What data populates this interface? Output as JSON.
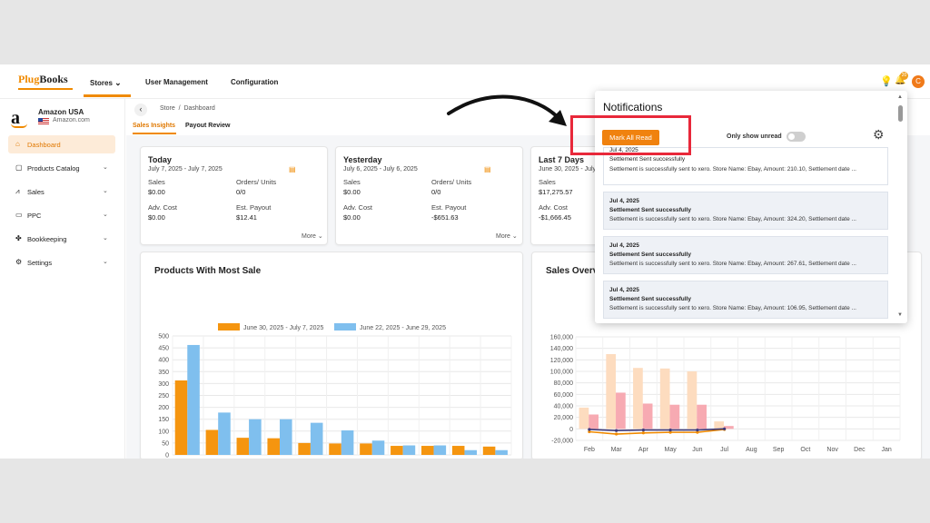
{
  "header": {
    "logo_part1": "Plug",
    "logo_part2": "Books",
    "nav": [
      "Stores",
      "User Management",
      "Configuration"
    ],
    "notification_count": "20",
    "avatar_initial": "C"
  },
  "store": {
    "name": "Amazon USA",
    "domain": "Amazon.com"
  },
  "sidebar": {
    "items": [
      {
        "label": "Dashboard",
        "icon": "home-icon",
        "active": true
      },
      {
        "label": "Products Catalog",
        "icon": "box-icon"
      },
      {
        "label": "Sales",
        "icon": "chart-icon"
      },
      {
        "label": "PPC",
        "icon": "ppc-icon"
      },
      {
        "label": "Bookkeeping",
        "icon": "book-icon"
      },
      {
        "label": "Settings",
        "icon": "gear-icon"
      }
    ]
  },
  "breadcrumb": {
    "store": "Store",
    "sep": "/",
    "page": "Dashboard"
  },
  "subtabs": [
    "Sales Insights",
    "Payout Review"
  ],
  "summary_cards": [
    {
      "title": "Today",
      "date": "July 7, 2025 - July 7, 2025",
      "sales_label": "Sales",
      "sales": "$0.00",
      "orders_label": "Orders/ Units",
      "orders": "0/0",
      "adv_label": "Adv. Cost",
      "adv": "$0.00",
      "payout_label": "Est. Payout",
      "payout": "$12.41",
      "more": "More"
    },
    {
      "title": "Yesterday",
      "date": "July 6, 2025 - July 6, 2025",
      "sales_label": "Sales",
      "sales": "$0.00",
      "orders_label": "Orders/ Units",
      "orders": "0/0",
      "adv_label": "Adv. Cost",
      "adv": "$0.00",
      "payout_label": "Est. Payout",
      "payout": "-$651.63",
      "more": "More"
    },
    {
      "title": "Last 7 Days",
      "date": "June 30, 2025 - July 6, 2025",
      "sales_label": "Sales",
      "sales": "$17,275.57",
      "adv_label": "Adv. Cost",
      "adv": "-$1,666.45"
    }
  ],
  "notifications": {
    "title": "Notifications",
    "mark_all": "Mark All Read",
    "only_unread": "Only show unread",
    "items": [
      {
        "date": "Jul 4, 2025",
        "title": "Settlement Sent successfully",
        "body": "Settlement is successfully sent to xero. Store Name: Ebay, Amount: 210.10, Settlement date ..."
      },
      {
        "date": "Jul 4, 2025",
        "title": "Settlement Sent successfully",
        "body": "Settlement is successfully sent to xero. Store Name: Ebay, Amount: 324.20, Settlement date ..."
      },
      {
        "date": "Jul 4, 2025",
        "title": "Settlement Sent successfully",
        "body": "Settlement is successfully sent to xero. Store Name: Ebay, Amount: 267.61, Settlement date ..."
      },
      {
        "date": "Jul 4, 2025",
        "title": "Settlement Sent successfully",
        "body": "Settlement is successfully sent to xero. Store Name: Ebay, Amount: 106.95, Settlement date ..."
      }
    ]
  },
  "colors": {
    "accent": "#f08a00",
    "series_a": "#f5950f",
    "series_b": "#7fbfee",
    "highlight": "#e8283a"
  },
  "chart_data": [
    {
      "type": "bar",
      "title": "Products With Most Sale",
      "ylim": [
        0,
        500
      ],
      "yticks": [
        0,
        50,
        100,
        150,
        200,
        250,
        300,
        350,
        400,
        450,
        500
      ],
      "categories": [
        "",
        "",
        "",
        "",
        "",
        "",
        "",
        "",
        "",
        "",
        ""
      ],
      "series": [
        {
          "name": "June 30, 2025 - July 7, 2025",
          "color": "#f5950f",
          "values": [
            313,
            105,
            72,
            70,
            50,
            48,
            48,
            38,
            38,
            38,
            35
          ]
        },
        {
          "name": "June 22, 2025 - June 29, 2025",
          "color": "#7fbfee",
          "values": [
            462,
            178,
            150,
            150,
            135,
            103,
            60,
            40,
            40,
            20,
            20
          ]
        }
      ],
      "legend": "top"
    },
    {
      "type": "bar",
      "title": "Sales Overv",
      "ylim": [
        -20000,
        160000
      ],
      "yticks": [
        -20000,
        0,
        20000,
        40000,
        60000,
        80000,
        100000,
        120000,
        140000,
        160000
      ],
      "ytick_labels": [
        "-20,000",
        "0",
        "20,000",
        "40,000",
        "60,000",
        "80,000",
        "100,000",
        "120,000",
        "140,000",
        "160,000"
      ],
      "categories": [
        "Feb",
        "Mar",
        "Apr",
        "May",
        "Jun",
        "Jul",
        "Aug",
        "Sep",
        "Oct",
        "Nov",
        "Dec",
        "Jan"
      ],
      "series": [
        {
          "kind": "bar",
          "color": "#fddcbf",
          "values": [
            37000,
            130000,
            106000,
            105000,
            100000,
            13000,
            0,
            0,
            0,
            0,
            0,
            0
          ]
        },
        {
          "kind": "bar",
          "color": "#f7aab2",
          "values": [
            25000,
            63000,
            44000,
            42000,
            42000,
            5000,
            0,
            0,
            0,
            0,
            0,
            0
          ]
        },
        {
          "kind": "line",
          "color": "#f08a00",
          "values": [
            -5000,
            -9000,
            -7000,
            -6000,
            -6000,
            -1000
          ]
        },
        {
          "kind": "line",
          "color": "#3d3a7a",
          "values": [
            -1000,
            -3000,
            -2000,
            -2000,
            -2000,
            0
          ]
        }
      ]
    }
  ]
}
